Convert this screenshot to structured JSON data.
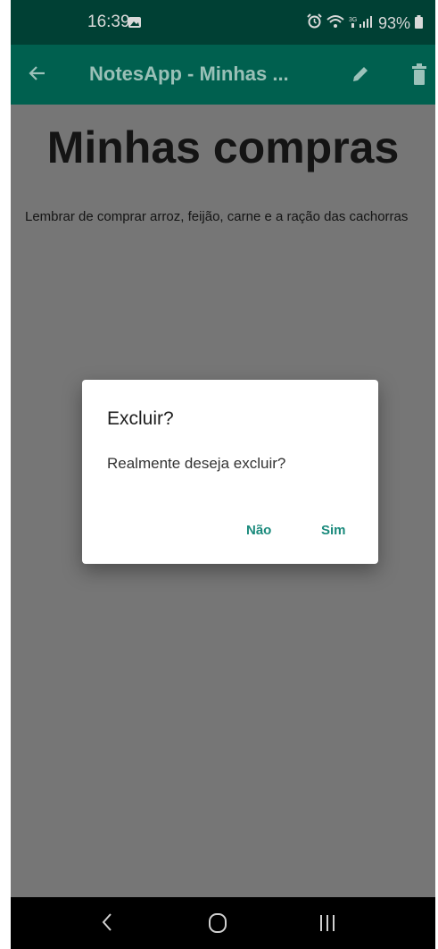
{
  "status_bar": {
    "time": "16:39",
    "battery": "93%",
    "icons": [
      "gallery-icon",
      "alarm-icon",
      "wifi-icon",
      "signal-icon",
      "battery-icon"
    ]
  },
  "app_bar": {
    "title": "NotesApp - Minhas ...",
    "icons": [
      "back-arrow-icon",
      "pencil-icon",
      "trash-icon"
    ]
  },
  "note": {
    "title": "Minhas compras",
    "body": "Lembrar de comprar arroz, feijão, carne e a ração das cachorras"
  },
  "dialog": {
    "title": "Excluir?",
    "message": "Realmente deseja excluir?",
    "no_label": "Não",
    "yes_label": "Sim",
    "accent": "#1a8a7c"
  },
  "nav_bar": {
    "icons": [
      "nav-back-icon",
      "nav-home-icon",
      "nav-recents-icon"
    ]
  },
  "colors": {
    "status_bar": "#004034",
    "app_bar": "#00604f",
    "scrim_background": "#767676"
  }
}
